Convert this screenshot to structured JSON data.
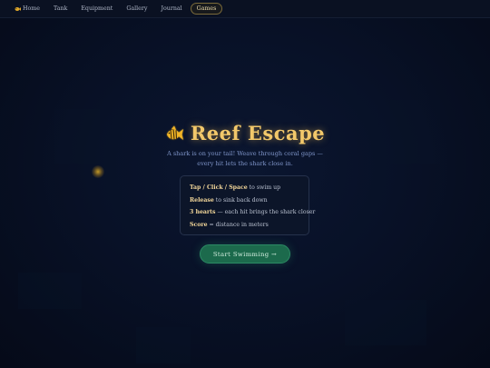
{
  "nav": {
    "items": [
      {
        "label": "Home",
        "icon": "fish-icon"
      },
      {
        "label": "Tank"
      },
      {
        "label": "Equipment"
      },
      {
        "label": "Gallery"
      },
      {
        "label": "Journal"
      },
      {
        "label": "Games",
        "active": true
      }
    ]
  },
  "game": {
    "title": "Reef Escape",
    "title_icon": "fish-icon",
    "subtitle_line1": "A shark is on your tail! Weave through coral gaps —",
    "subtitle_line2": "every hit lets the shark close in.",
    "instructions": [
      {
        "key": "Tap",
        "sep1": " / ",
        "key2": "Click",
        "sep2": " / ",
        "key3": "Space",
        "text": " to swim up"
      },
      {
        "key": "Release",
        "text": " to sink back down"
      },
      {
        "key": "3 hearts",
        "text": " — each hit brings the shark closer"
      },
      {
        "key": "Score",
        "text": " = distance in meters"
      }
    ],
    "start_label": "Start Swimming →"
  },
  "colors": {
    "accent_gold": "#f2c86a",
    "button_green": "#1c6a4c",
    "background": "#060c1c"
  }
}
